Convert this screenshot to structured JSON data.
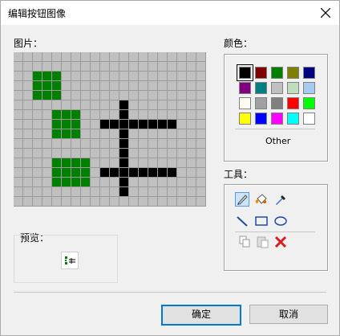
{
  "window": {
    "title": "编辑按钮图像"
  },
  "labels": {
    "picture": "图片：",
    "colors": "颜色：",
    "tools": "工具：",
    "preview": "预览：",
    "other": "Other"
  },
  "buttons": {
    "ok": "确定",
    "cancel": "取消"
  },
  "palette": [
    "#000000",
    "#800000",
    "#008000",
    "#808000",
    "#000080",
    "#800080",
    "#008080",
    "#c0c0c0",
    "#c0dcc0",
    "#a6caf0",
    "#fffbf0",
    "#a0a0a4",
    "#808080",
    "#ff0000",
    "#00ff00",
    "#ffff00",
    "#0000ff",
    "#ff00ff",
    "#00ffff",
    "#ffffff"
  ],
  "selected_color": "#000000",
  "icons": [
    "close-icon",
    "pencil-icon",
    "fill-icon",
    "eyedropper-icon",
    "line-icon",
    "rectangle-icon",
    "ellipse-icon",
    "copy-icon",
    "paste-icon",
    "clear-icon",
    "preview-image-icon"
  ],
  "picture_grid": [
    "....................",
    "....................",
    "..ggg...............",
    "..ggg...............",
    "..ggg...............",
    "...........k........",
    "....ggg....k........",
    "....ggg..kkkkkkkk...",
    "....ggg....k........",
    "...........k........",
    "...........k........",
    "....gggg...k........",
    "....gggg.kkkkkkkk...",
    "....gggg...k........",
    "...........k........",
    "...................."
  ]
}
